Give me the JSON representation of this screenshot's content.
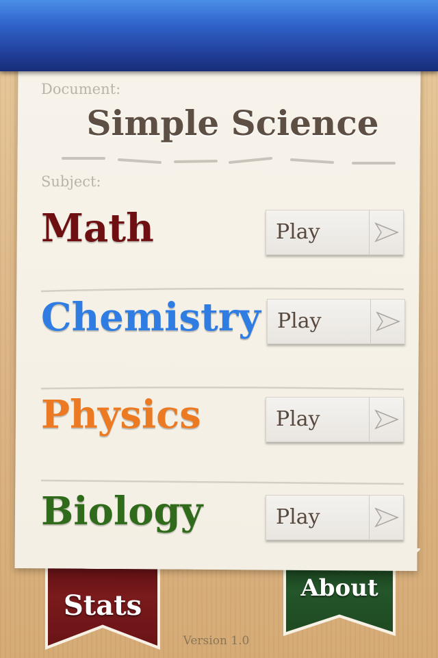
{
  "header": {
    "bar_color": "#2a4fb0",
    "bookmark_color": "#a87a20"
  },
  "document": {
    "label": "Document:",
    "title": "Simple Science",
    "subject_label": "Subject:"
  },
  "subjects": [
    {
      "name": "Math",
      "color": "#6e0f12",
      "button_label": "Play"
    },
    {
      "name": "Chemistry",
      "color": "#2f7de3",
      "button_label": "Play"
    },
    {
      "name": "Physics",
      "color": "#ec7a22",
      "button_label": "Play"
    },
    {
      "name": "Biology",
      "color": "#2f6b1a",
      "button_label": "Play"
    }
  ],
  "ribbons": {
    "stats": {
      "label": "Stats",
      "color": "#6e1518"
    },
    "about": {
      "label": "About",
      "color": "#1f4a22"
    }
  },
  "footer": {
    "version": "Version 1.0"
  },
  "icons": {
    "play_arrow": "play-arrow-icon"
  }
}
